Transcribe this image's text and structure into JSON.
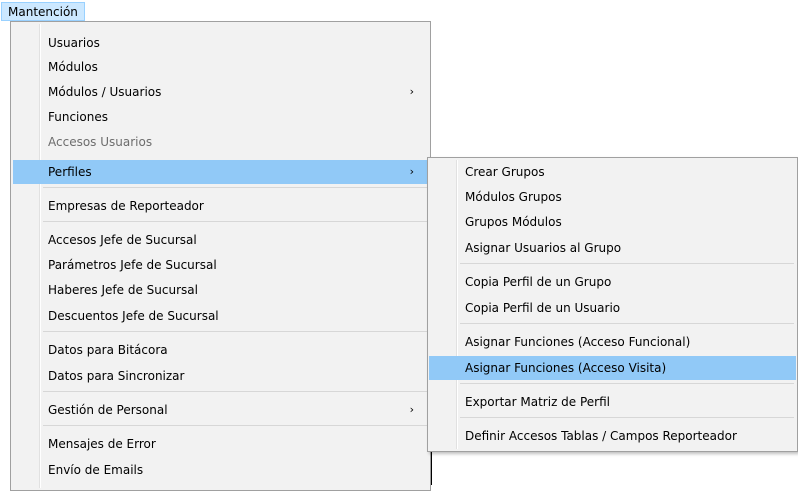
{
  "menubar": {
    "title": "Mantención"
  },
  "left_menu": {
    "items": [
      {
        "label": "Usuarios"
      },
      {
        "label": "Módulos"
      },
      {
        "label": "Módulos / Usuarios",
        "arrow": "›"
      },
      {
        "label": "Funciones"
      },
      {
        "label": "Accesos Usuarios"
      },
      {
        "label": "Perfiles",
        "arrow": "›"
      },
      {
        "label": "Empresas de Reporteador"
      },
      {
        "label": "Accesos Jefe de Sucursal"
      },
      {
        "label": "Parámetros Jefe de Sucursal"
      },
      {
        "label": "Haberes Jefe de Sucursal"
      },
      {
        "label": "Descuentos Jefe de Sucursal"
      },
      {
        "label": "Datos para Bitácora"
      },
      {
        "label": "Datos para Sincronizar"
      },
      {
        "label": "Gestión de Personal",
        "arrow": "›"
      },
      {
        "label": "Mensajes de Error"
      },
      {
        "label": "Envío de Emails"
      }
    ]
  },
  "right_menu": {
    "items": [
      {
        "label": "Crear Grupos"
      },
      {
        "label": "Módulos Grupos"
      },
      {
        "label": "Grupos Módulos"
      },
      {
        "label": "Asignar Usuarios al Grupo"
      },
      {
        "label": "Copia Perfil de un Grupo"
      },
      {
        "label": "Copia Perfil de un Usuario"
      },
      {
        "label": "Asignar Funciones (Acceso Funcional)"
      },
      {
        "label": "Asignar Funciones (Acceso Visita)"
      },
      {
        "label": "Exportar Matriz de Perfil"
      },
      {
        "label": "Definir Accesos Tablas / Campos Reporteador"
      }
    ]
  },
  "colors": {
    "highlight": "#91c9f7",
    "menu_bg": "#f2f2f2",
    "disabled_text": "#6d6d6d"
  }
}
